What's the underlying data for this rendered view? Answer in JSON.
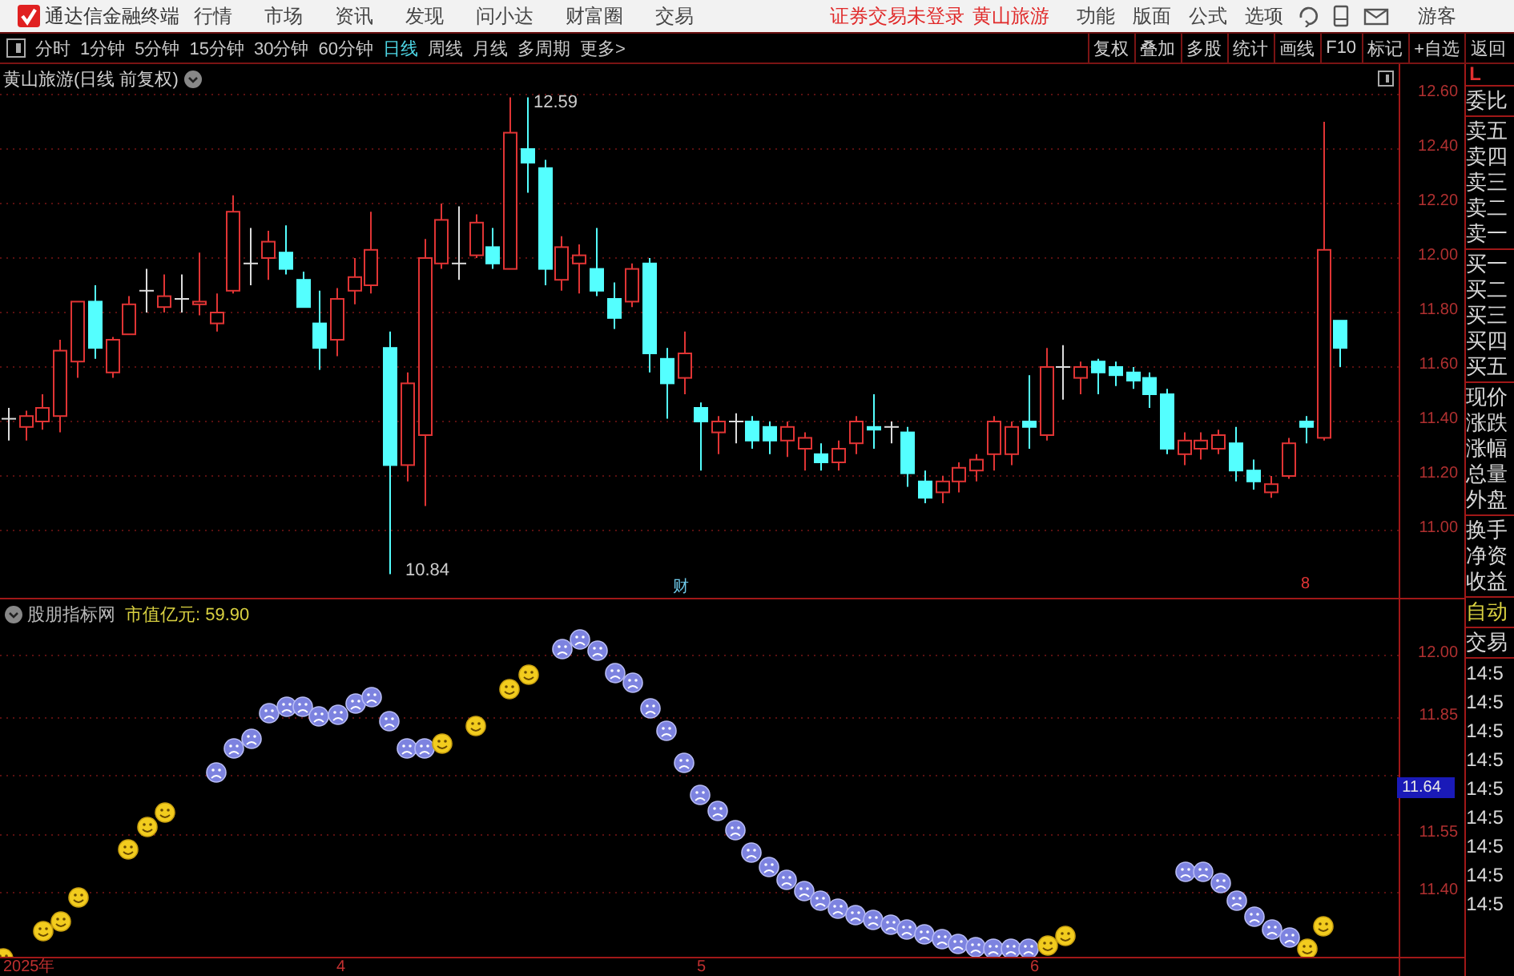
{
  "menu_bar": {
    "app_title": "通达信金融终端",
    "items": [
      "行情",
      "市场",
      "资讯",
      "发现",
      "问小达",
      "财富圈",
      "交易"
    ],
    "notice": "证券交易未登录",
    "stock_link": "黄山旅游",
    "right_items": [
      "功能",
      "版面",
      "公式",
      "选项"
    ],
    "user": "游客"
  },
  "period_tabs": [
    {
      "label": "分时",
      "selected": false
    },
    {
      "label": "1分钟",
      "selected": false
    },
    {
      "label": "5分钟",
      "selected": false
    },
    {
      "label": "15分钟",
      "selected": false
    },
    {
      "label": "30分钟",
      "selected": false
    },
    {
      "label": "60分钟",
      "selected": false
    },
    {
      "label": "日线",
      "selected": true
    },
    {
      "label": "周线",
      "selected": false
    },
    {
      "label": "月线",
      "selected": false
    },
    {
      "label": "多周期",
      "selected": false
    },
    {
      "label": "更多>",
      "selected": false
    }
  ],
  "tool_buttons": [
    "复权",
    "叠加",
    "多股",
    "统计",
    "画线",
    "F10",
    "标记",
    "+自选",
    "返回"
  ],
  "main_chart": {
    "title": "黄山旅游(日线 前复权)",
    "high_label": "12.59",
    "low_label": "10.84",
    "event_mark": "财",
    "event_mark_2": "8",
    "y_labels": [
      "12.60",
      "12.40",
      "12.20",
      "12.00",
      "11.80",
      "11.60",
      "11.40",
      "11.20",
      "11.00"
    ]
  },
  "indicator": {
    "name": "股朋指标网",
    "reading": "市值亿元: 59.90",
    "y_labels": [
      "12.00",
      "11.85",
      "11.55",
      "11.40"
    ],
    "current_value": "11.64"
  },
  "date_axis": [
    "2025年",
    "4",
    "5",
    "6"
  ],
  "side_panel": {
    "corner": "L",
    "groups": [
      [
        {
          "label": "委比",
          "highlighted": false
        }
      ],
      [
        {
          "label": "卖五",
          "highlighted": false
        },
        {
          "label": "卖四",
          "highlighted": false
        },
        {
          "label": "卖三",
          "highlighted": false
        },
        {
          "label": "卖二",
          "highlighted": false
        },
        {
          "label": "卖一",
          "highlighted": false
        }
      ],
      [
        {
          "label": "买一",
          "highlighted": false
        },
        {
          "label": "买二",
          "highlighted": false
        },
        {
          "label": "买三",
          "highlighted": false
        },
        {
          "label": "买四",
          "highlighted": false
        },
        {
          "label": "买五",
          "highlighted": false
        }
      ],
      [
        {
          "label": "现价",
          "highlighted": false
        },
        {
          "label": "涨跌",
          "highlighted": false
        },
        {
          "label": "涨幅",
          "highlighted": false
        },
        {
          "label": "总量",
          "highlighted": false
        },
        {
          "label": "外盘",
          "highlighted": false
        }
      ],
      [
        {
          "label": "换手",
          "highlighted": false
        },
        {
          "label": "净资",
          "highlighted": false
        },
        {
          "label": "收益",
          "highlighted": false
        }
      ],
      [
        {
          "label": "自动",
          "highlighted": true
        }
      ],
      [
        {
          "label": "交易",
          "highlighted": false
        }
      ]
    ],
    "times": [
      "14:5",
      "14:5",
      "14:5",
      "14:5",
      "14:5",
      "14:5",
      "14:5",
      "14:5",
      "14:5"
    ]
  }
}
